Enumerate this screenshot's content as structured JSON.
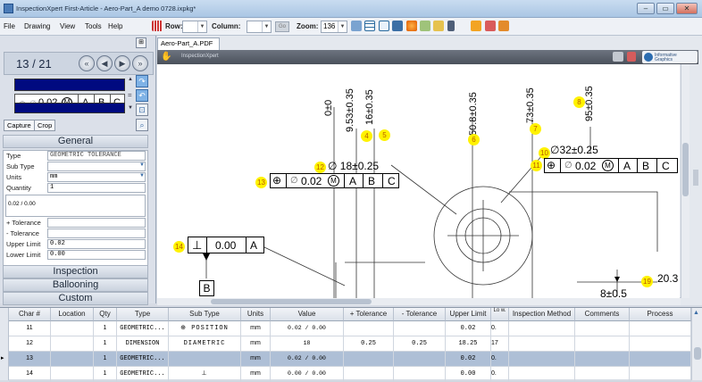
{
  "window": {
    "title": "InspectionXpert First-Article - Aero-Part_A demo 0728.ixpkg*"
  },
  "menu": [
    "File",
    "Drawing",
    "View",
    "Tools",
    "Help"
  ],
  "toolbar": {
    "row_label": "Row:",
    "column_label": "Column:",
    "go_label": "Go",
    "zoom_label": "Zoom:",
    "zoom_value": "136"
  },
  "left": {
    "page_counter": "13 / 21",
    "fcf_tol": "0.02",
    "fcf_mod": "M",
    "datums": [
      "A",
      "B",
      "C"
    ],
    "capture_label": "Capture",
    "crop_label": "Crop",
    "general_label": "General",
    "props": [
      {
        "label": "Type",
        "value": "GEOMETRIC TOLERANCE"
      },
      {
        "label": "Sub Type",
        "value": ""
      },
      {
        "label": "Units",
        "value": "mm"
      },
      {
        "label": "Quantity",
        "value": "1"
      }
    ],
    "note_value": "0.02 / 0.00",
    "props2": [
      {
        "label": "+ Tolerance",
        "value": ""
      },
      {
        "label": "- Tolerance",
        "value": ""
      },
      {
        "label": "Upper Limit",
        "value": "0.02"
      },
      {
        "label": "Lower Limit",
        "value": "0.00"
      }
    ],
    "sections": [
      "Inspection",
      "Ballooning",
      "Custom"
    ]
  },
  "viewer": {
    "tab": "Aero-Part_A.PDF",
    "bar_title": "InspectionXpert",
    "logo": "Informative Graphics",
    "dims": [
      {
        "text": "0±0",
        "balloon": ""
      },
      {
        "text": "9.53±0.35",
        "balloon": "4"
      },
      {
        "text": "16±0.35",
        "balloon": "5"
      },
      {
        "text": "50.8±0.35",
        "balloon": "6"
      },
      {
        "text": "73±0.35",
        "balloon": "7"
      },
      {
        "text": "95±0.35",
        "balloon": "8"
      }
    ],
    "callouts": {
      "b10": "10",
      "d10": "∅32±0.25",
      "b11": "11",
      "b12": "12",
      "d12": "∅ 18±0.25",
      "b13": "13",
      "b14": "14",
      "d14_tol": "0.00",
      "d14_datum": "A",
      "datum_b": "B",
      "b19": "19",
      "d19": "20.3",
      "partial": "8±0.5",
      "fcf_tol": "0.02",
      "fcf_mod": "M",
      "datums": [
        "A",
        "B",
        "C"
      ]
    }
  },
  "grid": {
    "headers": [
      "Char #",
      "Location",
      "Qty",
      "Type",
      "Sub Type",
      "Units",
      "Value",
      "+ Tolerance",
      "- Tolerance",
      "Upper Limit",
      "Lo w.",
      "Inspection Method",
      "Comments",
      "Process"
    ],
    "rows": [
      {
        "char": "11",
        "qty": "1",
        "type": "GEOMETRIC...",
        "sub": "⊕ POSITION",
        "units": "mm",
        "value": "0.02 / 0.00",
        "pt": "",
        "mt": "",
        "ul": "0.02",
        "lo": "0."
      },
      {
        "char": "12",
        "qty": "1",
        "type": "DIMENSION",
        "sub": "DIAMETRIC",
        "units": "mm",
        "value": "18",
        "pt": "0.25",
        "mt": "0.25",
        "ul": "18.25",
        "lo": "17"
      },
      {
        "char": "13",
        "qty": "1",
        "type": "GEOMETRIC...",
        "sub": "",
        "units": "mm",
        "value": "0.02 / 0.00",
        "pt": "",
        "mt": "",
        "ul": "0.02",
        "lo": "0."
      },
      {
        "char": "14",
        "qty": "1",
        "type": "GEOMETRIC...",
        "sub": "⊥",
        "units": "mm",
        "value": "0.00 / 0.00",
        "pt": "",
        "mt": "",
        "ul": "0.00",
        "lo": "0."
      }
    ]
  },
  "colors": {
    "navy": "#000a80",
    "balloon": "#fff200",
    "selected_row": "#aebfd6"
  }
}
